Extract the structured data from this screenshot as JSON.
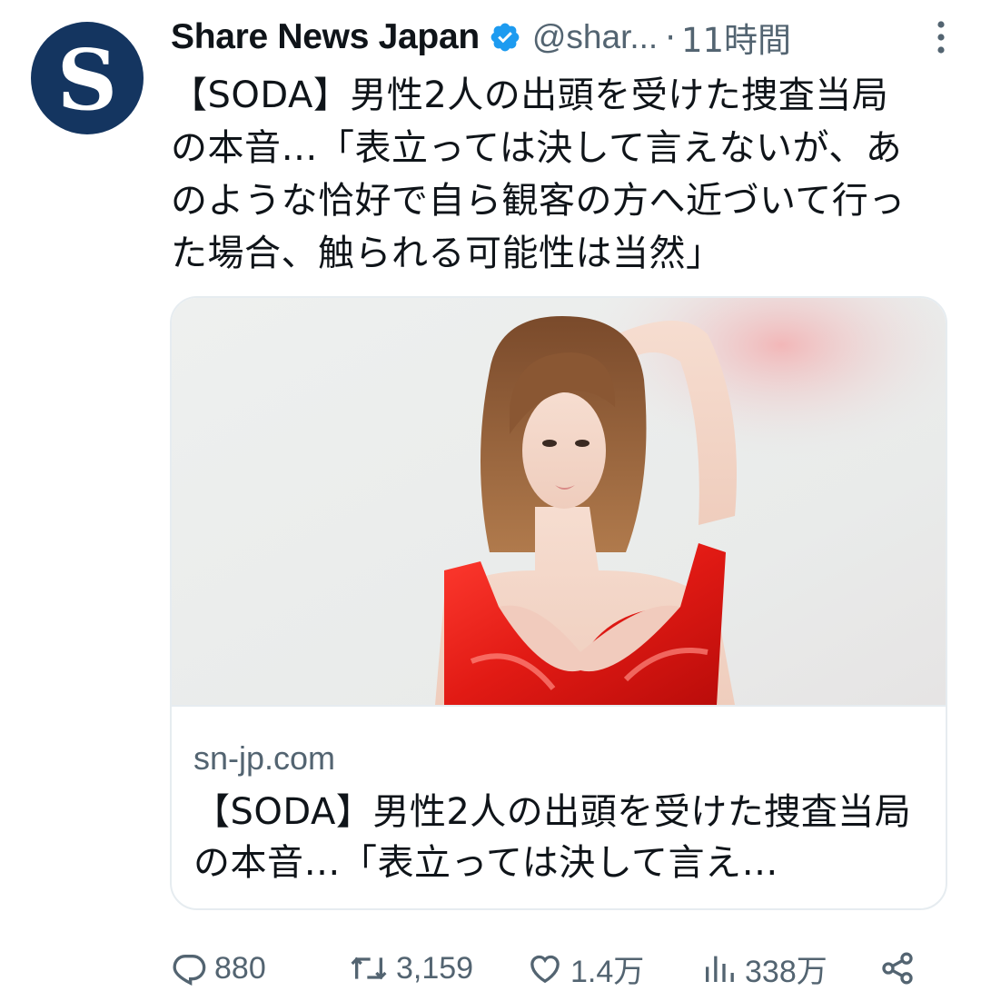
{
  "author": {
    "display_name": "Share News Japan",
    "handle": "@shar...",
    "time": "11時間",
    "avatar_letter": "S",
    "verified": true,
    "avatar_color": "#143560",
    "verified_color": "#1d9bf0"
  },
  "tweet": {
    "text": "【SODA】男性2人の出頭を受けた捜査当局の本音…「表立っては決して言えないが、あのような恰好で自ら観客の方へ近づいて行った場合、触られる可能性は当然」"
  },
  "card": {
    "image_icon": "photo-of-woman-in-red-latex-outfit",
    "domain": "sn-jp.com",
    "title": "【SODA】男性2人の出頭を受けた捜査当局の本音…「表立っては決して言え…"
  },
  "actions": {
    "replies": "880",
    "retweets": "3,159",
    "likes": "1.4万",
    "views": "338万"
  },
  "icons": {
    "reply": "reply-icon",
    "retweet": "retweet-icon",
    "like": "heart-icon",
    "views": "views-icon",
    "share": "share-icon",
    "more": "more-icon"
  }
}
